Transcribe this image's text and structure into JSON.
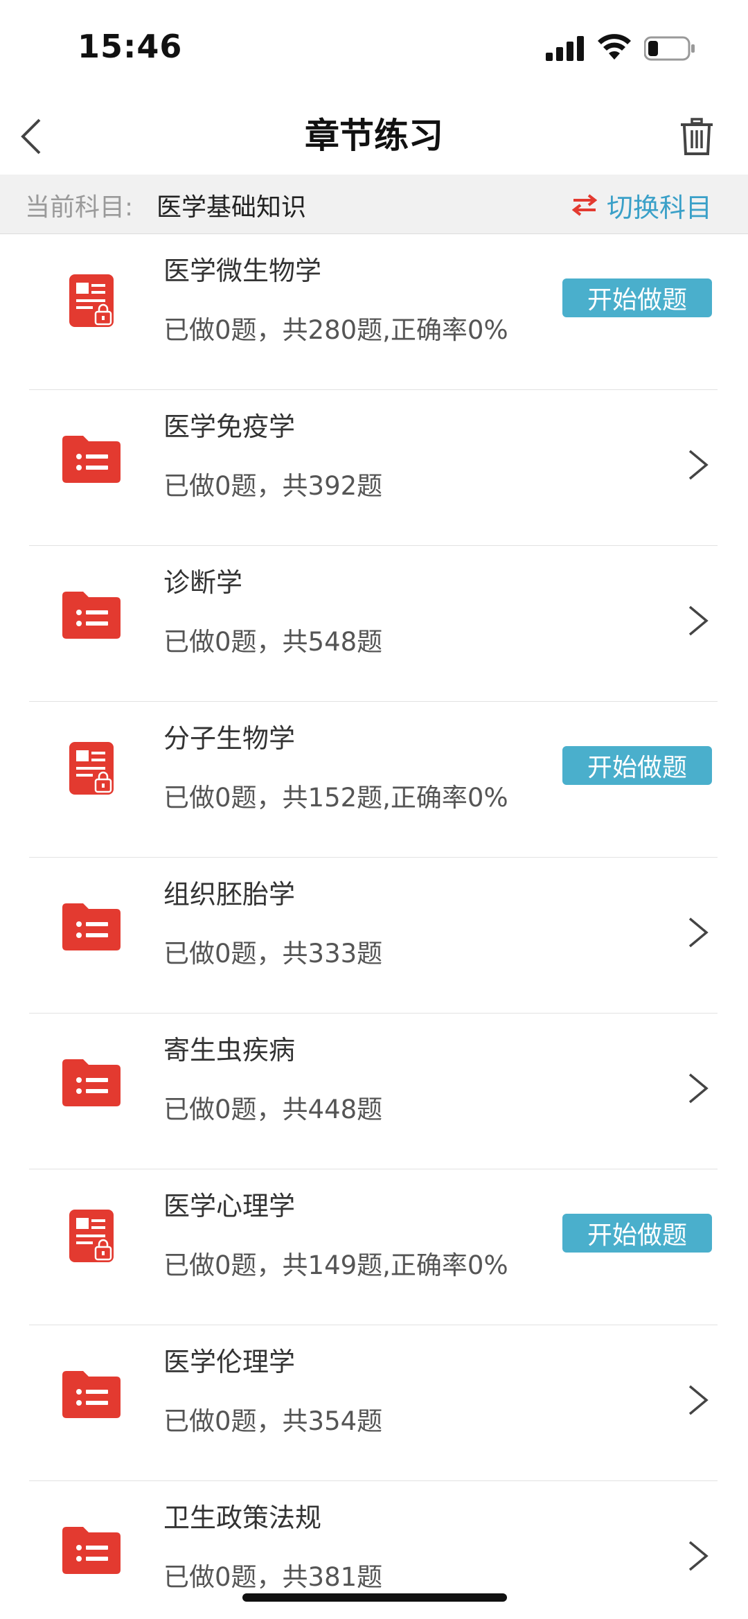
{
  "status_bar": {
    "time": "15:46"
  },
  "nav": {
    "title": "章节练习"
  },
  "subject_bar": {
    "label": "当前科目:",
    "value": "医学基础知识",
    "switch_label": "切换科目"
  },
  "colors": {
    "accent_red": "#e33a30",
    "accent_blue": "#4aafcc",
    "link_blue": "#3aa0c8"
  },
  "chapters": [
    {
      "title": "医学微生物学",
      "stats": "已做0题，共280题,正确率0%",
      "icon": "locked-document-icon",
      "action": "button",
      "button_label": "开始做题"
    },
    {
      "title": "医学免疫学",
      "stats": "已做0题，共392题",
      "icon": "folder-list-icon",
      "action": "chevron"
    },
    {
      "title": "诊断学",
      "stats": "已做0题，共548题",
      "icon": "folder-list-icon",
      "action": "chevron"
    },
    {
      "title": "分子生物学",
      "stats": "已做0题，共152题,正确率0%",
      "icon": "locked-document-icon",
      "action": "button",
      "button_label": "开始做题"
    },
    {
      "title": "组织胚胎学",
      "stats": "已做0题，共333题",
      "icon": "folder-list-icon",
      "action": "chevron"
    },
    {
      "title": "寄生虫疾病",
      "stats": "已做0题，共448题",
      "icon": "folder-list-icon",
      "action": "chevron"
    },
    {
      "title": "医学心理学",
      "stats": "已做0题，共149题,正确率0%",
      "icon": "locked-document-icon",
      "action": "button",
      "button_label": "开始做题"
    },
    {
      "title": "医学伦理学",
      "stats": "已做0题，共354题",
      "icon": "folder-list-icon",
      "action": "chevron"
    },
    {
      "title": "卫生政策法规",
      "stats": "已做0题，共381题",
      "icon": "folder-list-icon",
      "action": "chevron"
    }
  ]
}
